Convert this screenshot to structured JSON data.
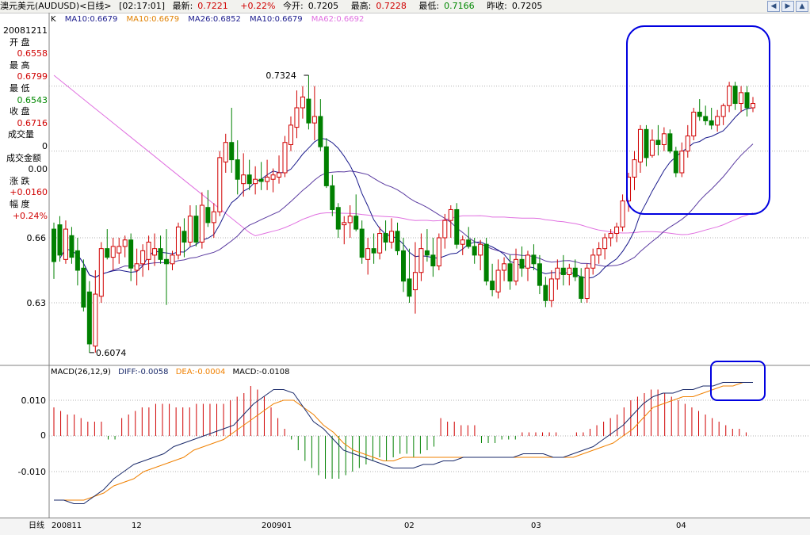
{
  "header": {
    "instrument": "澳元美元(AUDUSD)<日线>",
    "time": "[02:17:01]",
    "latest_label": "最新:",
    "latest_value": "0.7221",
    "change": "+0.22%",
    "open_label": "今开:",
    "open_value": "0.7205",
    "high_label": "最高:",
    "high_value": "0.7228",
    "low_label": "最低:",
    "low_value": "0.7166",
    "prevclose_label": "昨收:",
    "prevclose_value": "0.7205"
  },
  "legend": {
    "k": "K",
    "ma1": "MA10:0.6679",
    "ma2": "MA10:0.6679",
    "ma3": "MA26:0.6852",
    "ma4": "MA10:0.6679",
    "ma5": "MA62:0.6692"
  },
  "info": {
    "date": "20081211",
    "open_label": "开 盘",
    "open_value": "0.6558",
    "high_label": "最 高",
    "high_value": "0.6799",
    "low_label": "最 低",
    "low_value": "0.6543",
    "close_label": "收 盘",
    "close_value": "0.6716",
    "volume_label": "成交量",
    "volume_value": "0",
    "amount_label": "成交金额",
    "amount_value": "0.00",
    "change_label": "涨 跌",
    "change_value": "+0.0160",
    "pct_label": "幅 度",
    "pct_value": "+0.24%"
  },
  "macd_legend": {
    "name": "MACD(26,12,9)",
    "diff": "DIFF:-0.0058",
    "dea": "DEA:-0.0004",
    "macd": "MACD:-0.0108"
  },
  "x_axis": {
    "label": "日线",
    "ticks": [
      "200811",
      "12",
      "200901",
      "02",
      "03",
      "04"
    ]
  },
  "colors": {
    "up": "#d00000",
    "down": "#008000",
    "ma_short": "#1a1a8c",
    "ma_long": "#5a3aa0",
    "ma_62": "#e070e0",
    "diff": "#1a2a6a",
    "dea": "#f08000",
    "highlight": "#0000e0"
  },
  "chart_data": [
    {
      "type": "candlestick",
      "title": "",
      "ylim": [
        0.595,
        0.745
      ],
      "y_ticks": [
        0.63,
        0.66
      ],
      "y_tick_labels": [
        "0.63",
        "0.66"
      ],
      "annotations": [
        {
          "text": "0.6074",
          "value": 0.6074
        },
        {
          "text": "0.7324",
          "value": 0.7324
        }
      ],
      "candles_ohlc": [
        [
          0.664,
          0.667,
          0.641,
          0.649
        ],
        [
          0.666,
          0.67,
          0.649,
          0.652
        ],
        [
          0.65,
          0.668,
          0.648,
          0.664
        ],
        [
          0.661,
          0.665,
          0.648,
          0.651
        ],
        [
          0.654,
          0.66,
          0.638,
          0.645
        ],
        [
          0.646,
          0.65,
          0.626,
          0.628
        ],
        [
          0.635,
          0.64,
          0.607,
          0.611
        ],
        [
          0.61,
          0.645,
          0.607,
          0.634
        ],
        [
          0.633,
          0.658,
          0.63,
          0.655
        ],
        [
          0.655,
          0.664,
          0.65,
          0.651
        ],
        [
          0.651,
          0.66,
          0.645,
          0.656
        ],
        [
          0.653,
          0.66,
          0.648,
          0.656
        ],
        [
          0.656,
          0.661,
          0.651,
          0.659
        ],
        [
          0.659,
          0.662,
          0.64,
          0.646
        ],
        [
          0.645,
          0.655,
          0.638,
          0.648
        ],
        [
          0.648,
          0.657,
          0.642,
          0.654
        ],
        [
          0.65,
          0.661,
          0.645,
          0.658
        ],
        [
          0.652,
          0.662,
          0.647,
          0.655
        ],
        [
          0.655,
          0.661,
          0.648,
          0.65
        ],
        [
          0.65,
          0.664,
          0.629,
          0.648
        ],
        [
          0.648,
          0.654,
          0.645,
          0.652
        ],
        [
          0.652,
          0.667,
          0.65,
          0.665
        ],
        [
          0.663,
          0.669,
          0.651,
          0.658
        ],
        [
          0.658,
          0.675,
          0.656,
          0.67
        ],
        [
          0.67,
          0.675,
          0.656,
          0.658
        ],
        [
          0.658,
          0.681,
          0.655,
          0.675
        ],
        [
          0.674,
          0.682,
          0.665,
          0.667
        ],
        [
          0.667,
          0.676,
          0.66,
          0.672
        ],
        [
          0.672,
          0.7,
          0.67,
          0.697
        ],
        [
          0.695,
          0.708,
          0.69,
          0.704
        ],
        [
          0.704,
          0.72,
          0.69,
          0.696
        ],
        [
          0.696,
          0.705,
          0.68,
          0.687
        ],
        [
          0.685,
          0.699,
          0.679,
          0.689
        ],
        [
          0.689,
          0.696,
          0.682,
          0.685
        ],
        [
          0.685,
          0.693,
          0.68,
          0.687
        ],
        [
          0.687,
          0.695,
          0.682,
          0.686
        ],
        [
          0.686,
          0.696,
          0.682,
          0.688
        ],
        [
          0.687,
          0.692,
          0.681,
          0.689
        ],
        [
          0.688,
          0.698,
          0.685,
          0.69
        ],
        [
          0.69,
          0.707,
          0.688,
          0.704
        ],
        [
          0.703,
          0.716,
          0.7,
          0.712
        ],
        [
          0.711,
          0.728,
          0.706,
          0.72
        ],
        [
          0.72,
          0.73,
          0.715,
          0.725
        ],
        [
          0.724,
          0.735,
          0.71,
          0.713
        ],
        [
          0.713,
          0.73,
          0.705,
          0.716
        ],
        [
          0.716,
          0.724,
          0.7,
          0.702
        ],
        [
          0.702,
          0.706,
          0.683,
          0.684
        ],
        [
          0.684,
          0.689,
          0.67,
          0.673
        ],
        [
          0.674,
          0.676,
          0.66,
          0.664
        ],
        [
          0.666,
          0.67,
          0.657,
          0.667
        ],
        [
          0.667,
          0.675,
          0.66,
          0.67
        ],
        [
          0.67,
          0.68,
          0.663,
          0.664
        ],
        [
          0.664,
          0.668,
          0.648,
          0.651
        ],
        [
          0.65,
          0.66,
          0.643,
          0.655
        ],
        [
          0.655,
          0.662,
          0.648,
          0.653
        ],
        [
          0.653,
          0.665,
          0.65,
          0.662
        ],
        [
          0.662,
          0.668,
          0.654,
          0.658
        ],
        [
          0.658,
          0.669,
          0.655,
          0.663
        ],
        [
          0.663,
          0.667,
          0.652,
          0.654
        ],
        [
          0.654,
          0.66,
          0.635,
          0.64
        ],
        [
          0.641,
          0.655,
          0.63,
          0.633
        ],
        [
          0.636,
          0.658,
          0.625,
          0.644
        ],
        [
          0.644,
          0.662,
          0.64,
          0.655
        ],
        [
          0.654,
          0.664,
          0.649,
          0.652
        ],
        [
          0.652,
          0.66,
          0.642,
          0.647
        ],
        [
          0.647,
          0.662,
          0.645,
          0.66
        ],
        [
          0.66,
          0.671,
          0.655,
          0.668
        ],
        [
          0.668,
          0.675,
          0.66,
          0.673
        ],
        [
          0.673,
          0.676,
          0.655,
          0.657
        ],
        [
          0.657,
          0.661,
          0.652,
          0.659
        ],
        [
          0.659,
          0.665,
          0.655,
          0.656
        ],
        [
          0.656,
          0.66,
          0.648,
          0.652
        ],
        [
          0.652,
          0.659,
          0.645,
          0.657
        ],
        [
          0.657,
          0.66,
          0.638,
          0.64
        ],
        [
          0.64,
          0.648,
          0.633,
          0.636
        ],
        [
          0.635,
          0.65,
          0.632,
          0.645
        ],
        [
          0.645,
          0.651,
          0.64,
          0.648
        ],
        [
          0.648,
          0.652,
          0.636,
          0.64
        ],
        [
          0.64,
          0.655,
          0.638,
          0.65
        ],
        [
          0.65,
          0.656,
          0.642,
          0.646
        ],
        [
          0.646,
          0.654,
          0.64,
          0.652
        ],
        [
          0.652,
          0.657,
          0.645,
          0.648
        ],
        [
          0.648,
          0.652,
          0.634,
          0.638
        ],
        [
          0.638,
          0.642,
          0.628,
          0.631
        ],
        [
          0.631,
          0.645,
          0.628,
          0.641
        ],
        [
          0.641,
          0.65,
          0.636,
          0.646
        ],
        [
          0.646,
          0.652,
          0.638,
          0.643
        ],
        [
          0.643,
          0.648,
          0.638,
          0.646
        ],
        [
          0.646,
          0.65,
          0.64,
          0.642
        ],
        [
          0.642,
          0.646,
          0.63,
          0.632
        ],
        [
          0.632,
          0.648,
          0.63,
          0.646
        ],
        [
          0.646,
          0.655,
          0.643,
          0.652
        ],
        [
          0.652,
          0.658,
          0.648,
          0.655
        ],
        [
          0.655,
          0.662,
          0.65,
          0.66
        ],
        [
          0.66,
          0.664,
          0.656,
          0.662
        ],
        [
          0.662,
          0.667,
          0.658,
          0.665
        ],
        [
          0.665,
          0.68,
          0.663,
          0.677
        ],
        [
          0.677,
          0.69,
          0.672,
          0.688
        ],
        [
          0.688,
          0.7,
          0.682,
          0.696
        ],
        [
          0.695,
          0.712,
          0.69,
          0.71
        ],
        [
          0.71,
          0.712,
          0.693,
          0.697
        ],
        [
          0.698,
          0.71,
          0.697,
          0.705
        ],
        [
          0.705,
          0.712,
          0.698,
          0.703
        ],
        [
          0.703,
          0.711,
          0.7,
          0.708
        ],
        [
          0.708,
          0.71,
          0.699,
          0.7
        ],
        [
          0.7,
          0.702,
          0.688,
          0.69
        ],
        [
          0.69,
          0.704,
          0.688,
          0.7
        ],
        [
          0.7,
          0.712,
          0.697,
          0.707
        ],
        [
          0.707,
          0.72,
          0.705,
          0.718
        ],
        [
          0.718,
          0.724,
          0.714,
          0.716
        ],
        [
          0.716,
          0.721,
          0.712,
          0.714
        ],
        [
          0.714,
          0.72,
          0.71,
          0.712
        ],
        [
          0.712,
          0.719,
          0.709,
          0.716
        ],
        [
          0.716,
          0.722,
          0.712,
          0.721
        ],
        [
          0.721,
          0.732,
          0.718,
          0.73
        ],
        [
          0.73,
          0.732,
          0.719,
          0.722
        ],
        [
          0.722,
          0.73,
          0.718,
          0.727
        ],
        [
          0.727,
          0.73,
          0.716,
          0.72
        ],
        [
          0.72,
          0.725,
          0.718,
          0.722
        ]
      ]
    },
    {
      "type": "macd",
      "title": "",
      "ylim": [
        -0.022,
        0.018
      ],
      "y_ticks": [
        0.01,
        0,
        -0.01
      ],
      "y_tick_labels": [
        "0.010",
        "0",
        "-0.010"
      ],
      "series": [
        {
          "name": "DIFF",
          "values": [
            -0.018,
            -0.018,
            -0.019,
            -0.019,
            -0.017,
            -0.015,
            -0.012,
            -0.01,
            -0.008,
            -0.007,
            -0.006,
            -0.005,
            -0.003,
            -0.002,
            -0.001,
            0.0,
            0.001,
            0.002,
            0.003,
            0.006,
            0.009,
            0.011,
            0.013,
            0.013,
            0.012,
            0.008,
            0.004,
            0.002,
            -0.001,
            -0.004,
            -0.005,
            -0.006,
            -0.007,
            -0.008,
            -0.009,
            -0.009,
            -0.009,
            -0.008,
            -0.008,
            -0.007,
            -0.007,
            -0.006,
            -0.006,
            -0.006,
            -0.006,
            -0.006,
            -0.006,
            -0.005,
            -0.005,
            -0.005,
            -0.006,
            -0.006,
            -0.005,
            -0.004,
            -0.003,
            -0.001,
            0.001,
            0.003,
            0.006,
            0.009,
            0.011,
            0.012,
            0.012,
            0.013,
            0.013,
            0.014,
            0.014,
            0.015,
            0.015,
            0.015,
            0.015
          ]
        },
        {
          "name": "DEA",
          "values": [
            -0.018,
            -0.018,
            -0.018,
            -0.018,
            -0.017,
            -0.016,
            -0.014,
            -0.013,
            -0.012,
            -0.01,
            -0.009,
            -0.008,
            -0.007,
            -0.006,
            -0.004,
            -0.003,
            -0.002,
            -0.001,
            0.001,
            0.003,
            0.005,
            0.007,
            0.009,
            0.01,
            0.01,
            0.008,
            0.006,
            0.003,
            0.001,
            -0.002,
            -0.004,
            -0.005,
            -0.006,
            -0.007,
            -0.007,
            -0.006,
            -0.006,
            -0.006,
            -0.006,
            -0.006,
            -0.006,
            -0.006,
            -0.006,
            -0.006,
            -0.006,
            -0.006,
            -0.006,
            -0.006,
            -0.006,
            -0.006,
            -0.006,
            -0.006,
            -0.006,
            -0.005,
            -0.004,
            -0.003,
            -0.002,
            0.0,
            0.002,
            0.005,
            0.008,
            0.009,
            0.01,
            0.011,
            0.011,
            0.012,
            0.013,
            0.014,
            0.014,
            0.015,
            0.015
          ]
        },
        {
          "name": "MACD",
          "values": [
            0.008,
            0.007,
            0.006,
            0.006,
            0.005,
            0.004,
            0.004,
            0.004,
            -0.001,
            -0.001,
            0.005,
            0.006,
            0.007,
            0.008,
            0.008,
            0.009,
            0.009,
            0.009,
            0.008,
            0.008,
            0.008,
            0.009,
            0.009,
            0.009,
            0.009,
            0.009,
            0.01,
            0.011,
            0.012,
            0.014,
            0.013,
            0.011,
            0.008,
            0.005,
            0.002,
            -0.001,
            -0.004,
            -0.007,
            -0.009,
            -0.011,
            -0.012,
            -0.012,
            -0.012,
            -0.011,
            -0.01,
            -0.009,
            -0.008,
            -0.007,
            -0.006,
            -0.007,
            -0.006,
            -0.005,
            -0.005,
            -0.006,
            -0.005,
            -0.004,
            -0.003,
            0.005,
            0.004,
            0.004,
            0.003,
            0.003,
            0.003,
            -0.002,
            -0.002,
            -0.002,
            -0.001,
            -0.001,
            -0.001,
            0.001,
            0.001,
            0.001,
            0.001,
            0.001,
            0.001,
            0.0,
            0.0,
            0.001,
            0.001,
            0.002,
            0.003,
            0.004,
            0.005,
            0.006,
            0.008,
            0.01,
            0.011,
            0.012,
            0.013,
            0.013,
            0.012,
            0.011,
            0.01,
            0.009,
            0.008,
            0.007,
            0.006,
            0.005,
            0.004,
            0.003,
            0.002,
            0.002,
            0.001,
            0.0
          ]
        }
      ]
    }
  ]
}
